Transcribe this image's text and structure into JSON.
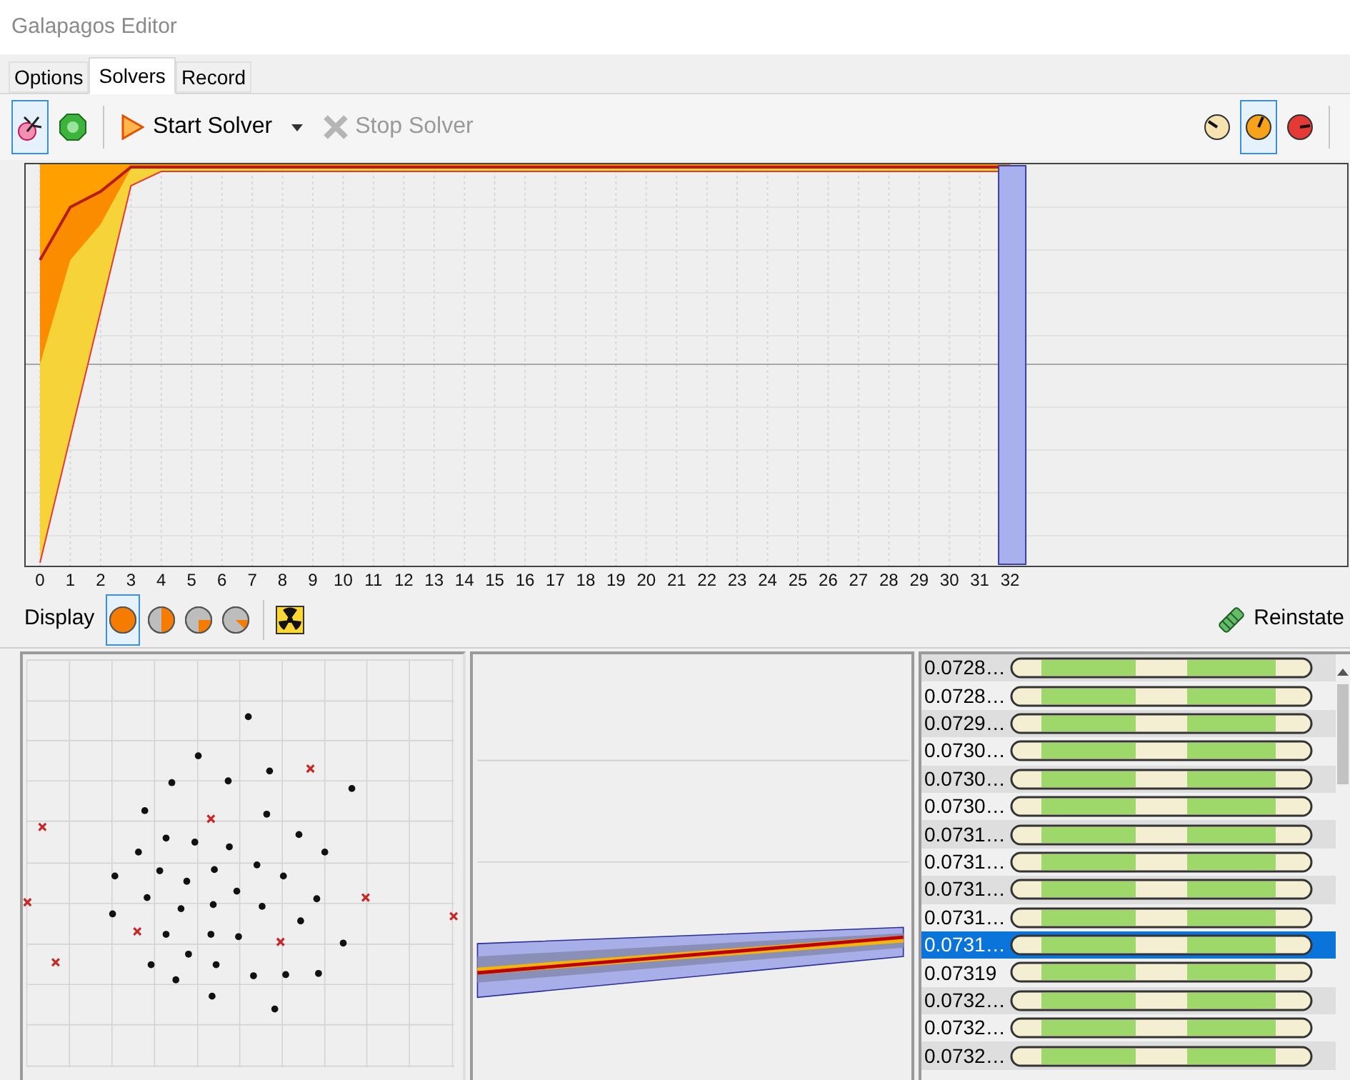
{
  "window": {
    "title": "Galapagos Editor"
  },
  "tabs": [
    {
      "label": "Options",
      "selected": false
    },
    {
      "label": "Solvers",
      "selected": true
    },
    {
      "label": "Record",
      "selected": false
    }
  ],
  "toolbar": {
    "toggles": [
      {
        "kind": "pin",
        "selected": true
      },
      {
        "kind": "gem",
        "selected": false
      }
    ],
    "start_button": "Start Solver",
    "stop_button": {
      "label": "Stop Solver",
      "disabled": true
    },
    "speeds": [
      {
        "kind": "slow",
        "selected": false
      },
      {
        "kind": "medium",
        "selected": true
      },
      {
        "kind": "fast",
        "selected": false
      }
    ]
  },
  "chart": {
    "generation_labels": [
      "0",
      "1",
      "2",
      "3",
      "4",
      "5",
      "6",
      "7",
      "8",
      "9",
      "10",
      "11",
      "12",
      "13",
      "14",
      "15",
      "16",
      "17",
      "18",
      "19",
      "20",
      "21",
      "22",
      "23",
      "24",
      "25",
      "26",
      "27",
      "28",
      "29",
      "30",
      "31",
      "32"
    ]
  },
  "display_bar": {
    "label": "Display",
    "modes": [
      {
        "kind": "full",
        "selected": true
      },
      {
        "kind": "half",
        "selected": false
      },
      {
        "kind": "quarter",
        "selected": false
      },
      {
        "kind": "eighth",
        "selected": false
      }
    ],
    "reinstate_button": "Reinstate"
  },
  "genomes": [
    {
      "value": "0.0728…",
      "selected": false
    },
    {
      "value": "0.0728…",
      "selected": false
    },
    {
      "value": "0.0729…",
      "selected": false
    },
    {
      "value": "0.0730…",
      "selected": false
    },
    {
      "value": "0.0730…",
      "selected": false
    },
    {
      "value": "0.0730…",
      "selected": false
    },
    {
      "value": "0.0731…",
      "selected": false
    },
    {
      "value": "0.0731…",
      "selected": false
    },
    {
      "value": "0.0731…",
      "selected": false
    },
    {
      "value": "0.0731…",
      "selected": false
    },
    {
      "value": "0.0731…",
      "selected": true
    },
    {
      "value": "0.07319",
      "selected": false
    },
    {
      "value": "0.0732…",
      "selected": false
    },
    {
      "value": "0.0732…",
      "selected": false
    },
    {
      "value": "0.0732…",
      "selected": false
    }
  ]
}
